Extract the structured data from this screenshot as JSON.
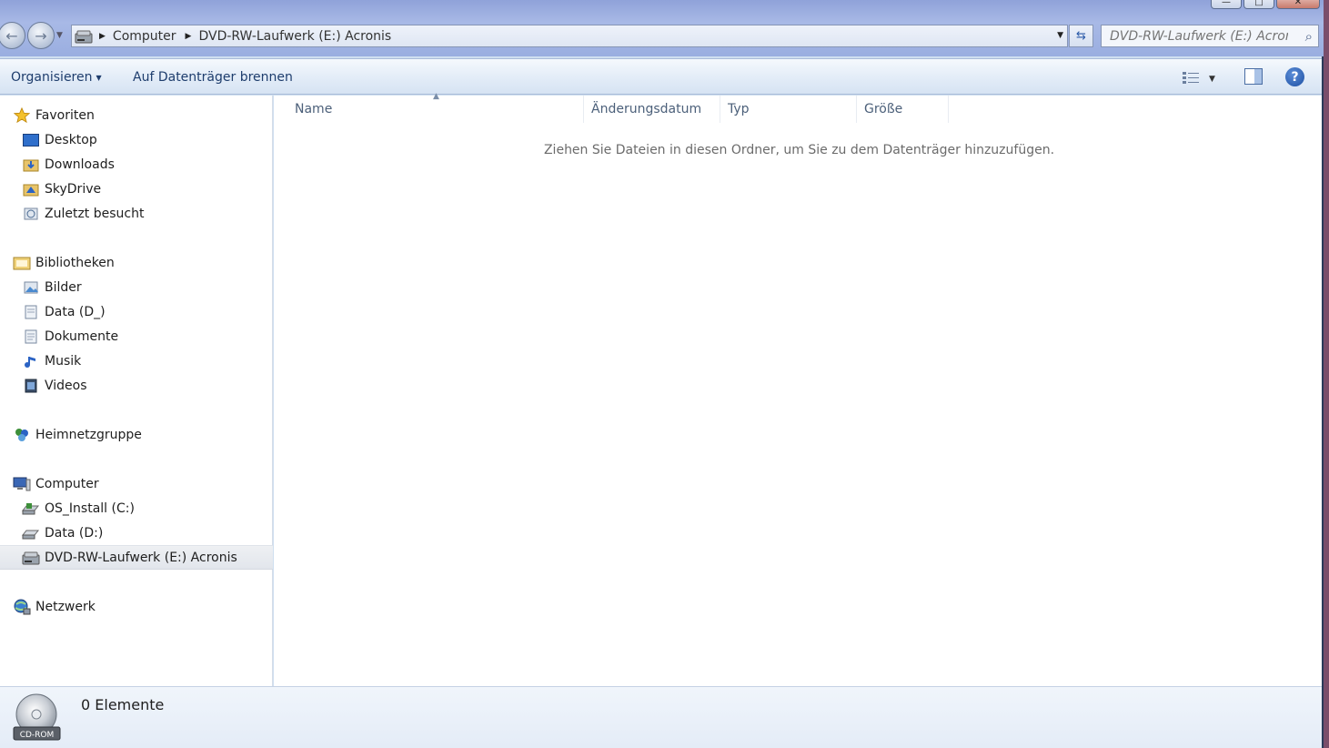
{
  "window": {
    "controls": {
      "minimize": "—",
      "maximize": "□",
      "close": "✕"
    }
  },
  "address": {
    "crumbs": [
      "Computer",
      "DVD-RW-Laufwerk (E:) Acronis"
    ]
  },
  "search": {
    "placeholder": "DVD-RW-Laufwerk (E:) Acroni..."
  },
  "toolbar": {
    "organize_label": "Organisieren",
    "burn_label": "Auf Datenträger brennen"
  },
  "sidebar": {
    "favorites": {
      "label": "Favoriten",
      "items": [
        "Desktop",
        "Downloads",
        "SkyDrive",
        "Zuletzt besucht"
      ]
    },
    "libraries": {
      "label": "Bibliotheken",
      "items": [
        "Bilder",
        "Data (D_)",
        "Dokumente",
        "Musik",
        "Videos"
      ]
    },
    "homegroup": {
      "label": "Heimnetzgruppe"
    },
    "computer": {
      "label": "Computer",
      "items": [
        "OS_Install (C:)",
        "Data (D:)",
        "DVD-RW-Laufwerk (E:) Acronis"
      ],
      "selected_index": 2
    },
    "network": {
      "label": "Netzwerk"
    }
  },
  "columns": {
    "name": "Name",
    "date": "Änderungsdatum",
    "type": "Typ",
    "size": "Größe"
  },
  "content": {
    "empty_message": "Ziehen Sie Dateien in diesen Ordner, um Sie zu dem Datenträger hinzuzufügen."
  },
  "status": {
    "count": "0 Elemente",
    "drive_badge": "CD-ROM"
  }
}
